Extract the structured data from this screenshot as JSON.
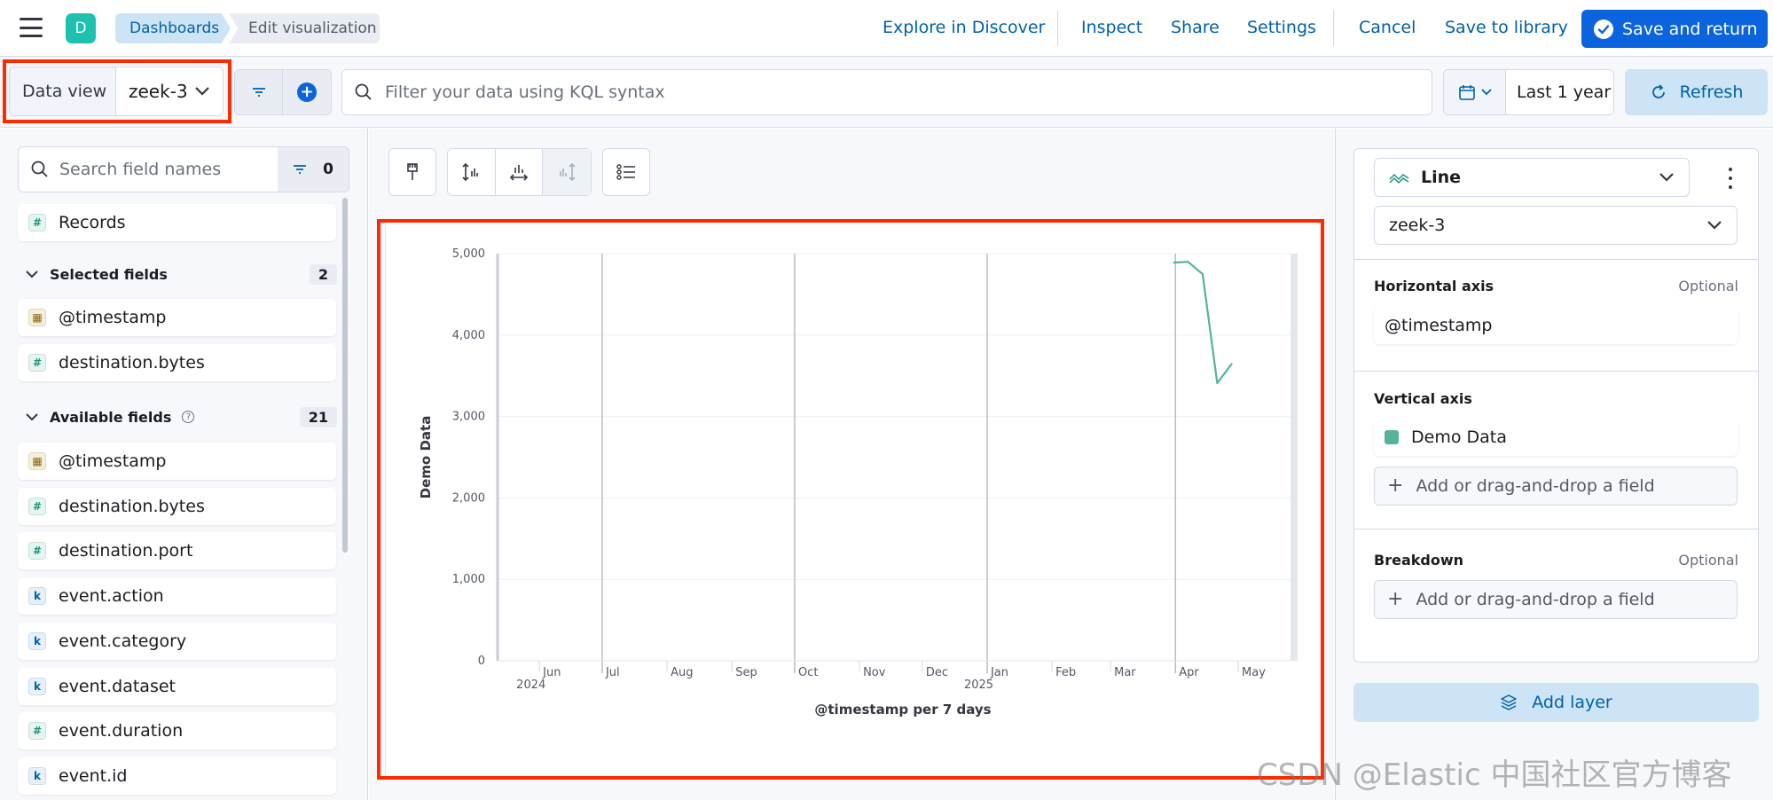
{
  "header": {
    "space_initial": "D",
    "breadcrumbs": [
      "Dashboards",
      "Edit visualization"
    ],
    "links": {
      "explore": "Explore in Discover",
      "inspect": "Inspect",
      "share": "Share",
      "settings": "Settings",
      "cancel": "Cancel",
      "save_library": "Save to library"
    },
    "save_return_label": "Save and return"
  },
  "query_bar": {
    "data_view_label": "Data view",
    "data_view_value": "zeek-3",
    "kql_placeholder": "Filter your data using KQL syntax",
    "time_range": "Last 1 year",
    "refresh_label": "Refresh"
  },
  "fields_panel": {
    "search_placeholder": "Search field names",
    "filter_count": "0",
    "records_label": "Records",
    "selected_title": "Selected fields",
    "selected_count": "2",
    "selected": [
      {
        "name": "@timestamp",
        "type": "date"
      },
      {
        "name": "destination.bytes",
        "type": "number"
      }
    ],
    "available_title": "Available fields",
    "available_count": "21",
    "available": [
      {
        "name": "@timestamp",
        "type": "date"
      },
      {
        "name": "destination.bytes",
        "type": "number"
      },
      {
        "name": "destination.port",
        "type": "number"
      },
      {
        "name": "event.action",
        "type": "keyword"
      },
      {
        "name": "event.category",
        "type": "keyword"
      },
      {
        "name": "event.dataset",
        "type": "keyword"
      },
      {
        "name": "event.duration",
        "type": "number"
      },
      {
        "name": "event.id",
        "type": "keyword"
      }
    ],
    "type_glyphs": {
      "number": "#",
      "keyword": "k",
      "date": "▦"
    }
  },
  "config_panel": {
    "chart_type": "Line",
    "data_view": "zeek-3",
    "horizontal_axis_label": "Horizontal axis",
    "horizontal_axis_value": "@timestamp",
    "optional_label": "Optional",
    "vertical_axis_label": "Vertical axis",
    "vertical_axis_value": "Demo Data",
    "vertical_axis_color": "#54b399",
    "add_field_label": "Add or drag-and-drop a field",
    "breakdown_label": "Breakdown",
    "add_layer_label": "Add layer"
  },
  "watermark": "CSDN @Elastic 中国社区官方博客",
  "chart_data": {
    "type": "line",
    "ylabel": "Demo Data",
    "xlabel": "@timestamp per 7 days",
    "ylim": [
      0,
      5000
    ],
    "yticks": [
      0,
      1000,
      2000,
      3000,
      4000,
      5000
    ],
    "ytick_labels": [
      "0",
      "1,000",
      "2,000",
      "3,000",
      "4,000",
      "5,000"
    ],
    "x_domain": [
      "2024-05-12",
      "2025-05-26"
    ],
    "xticks": [
      {
        "date": "2024-06-01",
        "label": "Jun",
        "sub": "2024"
      },
      {
        "date": "2024-07-01",
        "label": "Jul",
        "sub": ""
      },
      {
        "date": "2024-08-01",
        "label": "Aug",
        "sub": ""
      },
      {
        "date": "2024-09-01",
        "label": "Sep",
        "sub": ""
      },
      {
        "date": "2024-10-01",
        "label": "Oct",
        "sub": ""
      },
      {
        "date": "2024-11-01",
        "label": "Nov",
        "sub": ""
      },
      {
        "date": "2024-12-01",
        "label": "Dec",
        "sub": ""
      },
      {
        "date": "2025-01-01",
        "label": "Jan",
        "sub": "2025"
      },
      {
        "date": "2025-02-01",
        "label": "Feb",
        "sub": ""
      },
      {
        "date": "2025-03-01",
        "label": "Mar",
        "sub": ""
      },
      {
        "date": "2025-04-01",
        "label": "Apr",
        "sub": ""
      },
      {
        "date": "2025-05-01",
        "label": "May",
        "sub": ""
      }
    ],
    "series": [
      {
        "color": "#54b399",
        "x": [
          "2025-03-31",
          "2025-04-07",
          "2025-04-14",
          "2025-04-21",
          "2025-04-28"
        ],
        "y": [
          4890,
          4900,
          4750,
          3410,
          3650
        ]
      }
    ],
    "grid": true
  }
}
